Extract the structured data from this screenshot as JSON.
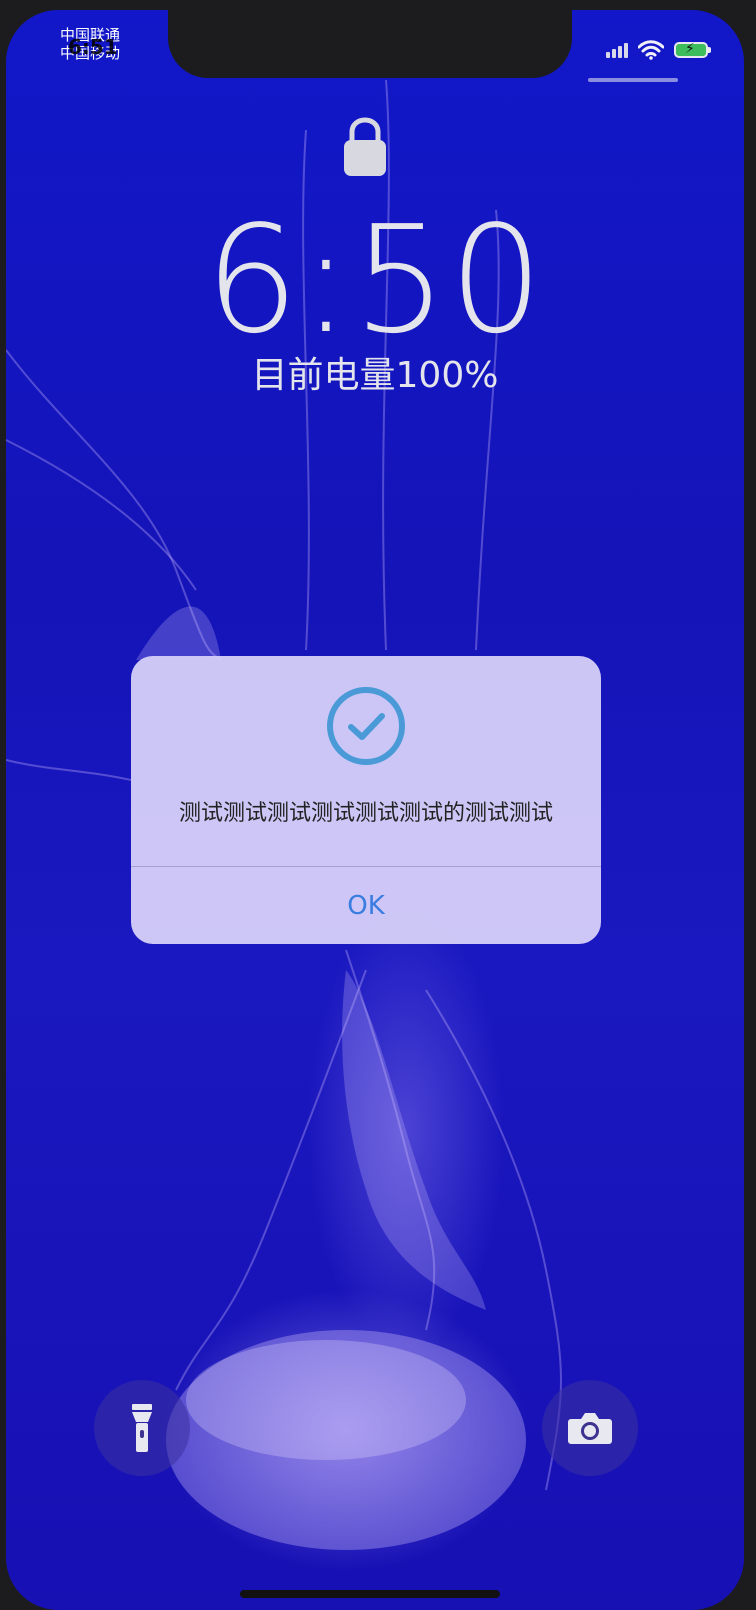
{
  "status_bar": {
    "carrier_primary": "中国联通",
    "carrier_secondary": "中国移动",
    "time_overlay": "6:51"
  },
  "lock_screen": {
    "time": "6:50",
    "battery_text": "目前电量100%"
  },
  "alert": {
    "message": "测试测试测试测试测试测试的测试测试",
    "ok_label": "OK"
  },
  "colors": {
    "accent": "#3a7de0",
    "checkmark": "#4a9ad8",
    "wallpaper": "#1414b8"
  },
  "icons": {
    "lock": "lock-icon",
    "check": "check-circle-icon",
    "flashlight": "flashlight-icon",
    "camera": "camera-icon",
    "wifi": "wifi-icon",
    "signal": "signal-icon",
    "battery": "battery-icon"
  }
}
